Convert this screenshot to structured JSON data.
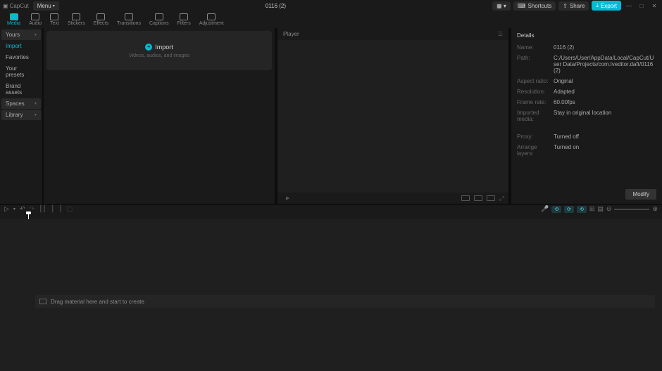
{
  "app": {
    "name": "CapCut",
    "menu": "Menu",
    "title": "0116 (2)"
  },
  "titlebar_buttons": {
    "shortcuts": "Shortcuts",
    "share": "Share",
    "export": "Export"
  },
  "tools": [
    {
      "label": "Media",
      "active": true
    },
    {
      "label": "Audio"
    },
    {
      "label": "Text"
    },
    {
      "label": "Stickers"
    },
    {
      "label": "Effects"
    },
    {
      "label": "Transitions"
    },
    {
      "label": "Captions"
    },
    {
      "label": "Filters"
    },
    {
      "label": "Adjustment"
    }
  ],
  "sidebar": {
    "items": [
      {
        "label": "Yours",
        "chev": true,
        "active": true
      },
      {
        "label": "Import",
        "highlight": true
      },
      {
        "label": "Favorites"
      },
      {
        "label": "Your presets"
      },
      {
        "label": "Brand assets"
      },
      {
        "label": "Spaces",
        "chev": true,
        "active": true
      },
      {
        "label": "Library",
        "chev": true,
        "active": true
      }
    ]
  },
  "import_box": {
    "label": "Import",
    "sub": "Videos, audios, and images"
  },
  "player": {
    "title": "Player"
  },
  "details": {
    "title": "Details",
    "rows": [
      {
        "label": "Name:",
        "value": "0116 (2)"
      },
      {
        "label": "Path:",
        "value": "C:/Users/User/AppData/Local/CapCut/User Data/Projects/com.lveditor.daft/0116 (2)"
      },
      {
        "label": "Aspect ratio:",
        "value": "Original"
      },
      {
        "label": "Resolution:",
        "value": "Adapted"
      },
      {
        "label": "Frame rate:",
        "value": "60.00fps"
      },
      {
        "label": "Imported media:",
        "value": "Stay in original location"
      }
    ],
    "rows2": [
      {
        "label": "Proxy:",
        "value": "Turned off"
      },
      {
        "label": "Arrange layers:",
        "value": "Turned on"
      }
    ],
    "modify": "Modify"
  },
  "timeline": {
    "message": "Drag material here and start to create"
  }
}
